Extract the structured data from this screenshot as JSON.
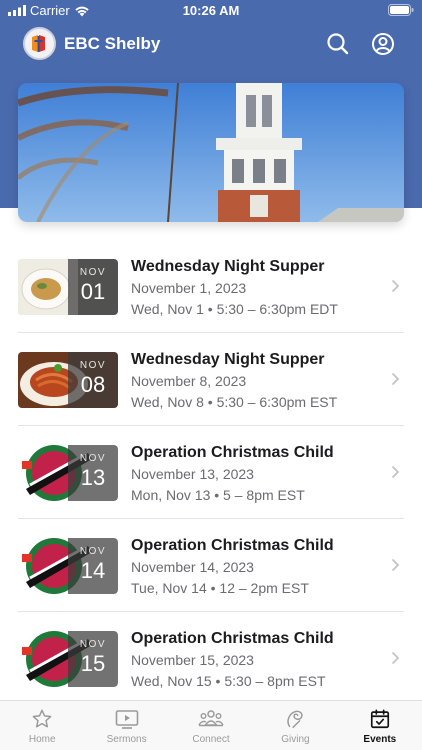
{
  "status_bar": {
    "carrier": "Carrier",
    "time": "10:26 AM"
  },
  "header": {
    "title": "EBC Shelby",
    "logo": "church-logo",
    "search_icon": "search-icon",
    "profile_icon": "profile-icon"
  },
  "hero": {
    "image": "church-steeple-photo"
  },
  "events": [
    {
      "title": "Wednesday Night Supper",
      "date": "November 1, 2023",
      "time": "Wed, Nov 1 • 5:30 – 6:30pm EDT",
      "badge_month": "NOV",
      "badge_day": "01",
      "thumb": "supper-plate"
    },
    {
      "title": "Wednesday Night Supper",
      "date": "November 8, 2023",
      "time": "Wed, Nov 8 • 5:30 – 6:30pm EST",
      "badge_month": "NOV",
      "badge_day": "08",
      "thumb": "spaghetti"
    },
    {
      "title": "Operation Christmas Child",
      "date": "November 13, 2023",
      "time": "Mon, Nov 13 • 5 – 8pm EST",
      "badge_month": "NOV",
      "badge_day": "13",
      "thumb": "occ-logo"
    },
    {
      "title": "Operation Christmas Child",
      "date": "November 14, 2023",
      "time": "Tue, Nov 14 • 12 – 2pm EST",
      "badge_month": "NOV",
      "badge_day": "14",
      "thumb": "occ-logo"
    },
    {
      "title": "Operation Christmas Child",
      "date": "November 15, 2023",
      "time": "Wed, Nov 15 • 5:30 – 8pm EST",
      "badge_month": "NOV",
      "badge_day": "15",
      "thumb": "occ-logo"
    }
  ],
  "tabs": [
    {
      "label": "Home",
      "icon": "star-icon",
      "active": false
    },
    {
      "label": "Sermons",
      "icon": "video-icon",
      "active": false
    },
    {
      "label": "Connect",
      "icon": "people-icon",
      "active": false
    },
    {
      "label": "Giving",
      "icon": "giving-icon",
      "active": false
    },
    {
      "label": "Events",
      "icon": "calendar-icon",
      "active": true
    }
  ],
  "colors": {
    "header_blue": "#4a6aae",
    "text_primary": "#1c1c1e",
    "text_secondary": "#6b6b70",
    "tab_inactive": "#9a9a9a",
    "tab_active": "#111111"
  }
}
